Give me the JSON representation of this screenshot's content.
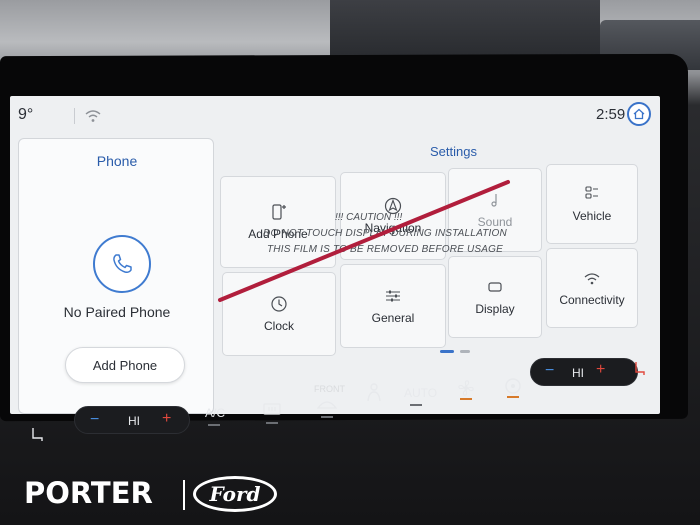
{
  "status_bar": {
    "temperature": "9°",
    "time": "2:59"
  },
  "phone_card": {
    "title": "Phone",
    "status": "No Paired Phone",
    "add_button": "Add Phone"
  },
  "settings": {
    "title": "Settings",
    "tiles": [
      {
        "label": "Add Phone",
        "icon": "add-phone-icon"
      },
      {
        "label": "Navigation",
        "icon": "navigation-icon"
      },
      {
        "label": "Sound",
        "icon": "sound-icon"
      },
      {
        "label": "Vehicle",
        "icon": "vehicle-icon"
      },
      {
        "label": "Clock",
        "icon": "clock-icon"
      },
      {
        "label": "General",
        "icon": "sliders-icon"
      },
      {
        "label": "Display",
        "icon": "display-icon"
      },
      {
        "label": "Connectivity",
        "icon": "wifi-icon"
      }
    ]
  },
  "protective_film": {
    "caution": "!!! CAUTION !!!",
    "line1": "DO NOT TOUCH DISPLAY DURING INSTALLATION",
    "line2": "THIS FILM IS TO BE REMOVED BEFORE USAGE"
  },
  "climate": {
    "left_fan_level": "HI",
    "ac_label": "A/C",
    "front_label": "FRONT",
    "auto_label": "AUTO",
    "right_fan_level": "HI",
    "minus": "−",
    "plus": "+"
  },
  "branding": {
    "dealer": "PORTER",
    "brand": "Ford"
  },
  "colors": {
    "accent": "#3a73c9",
    "heat": "#e0483d",
    "cool": "#4a8fe0",
    "film_slash": "#b11e3c"
  }
}
